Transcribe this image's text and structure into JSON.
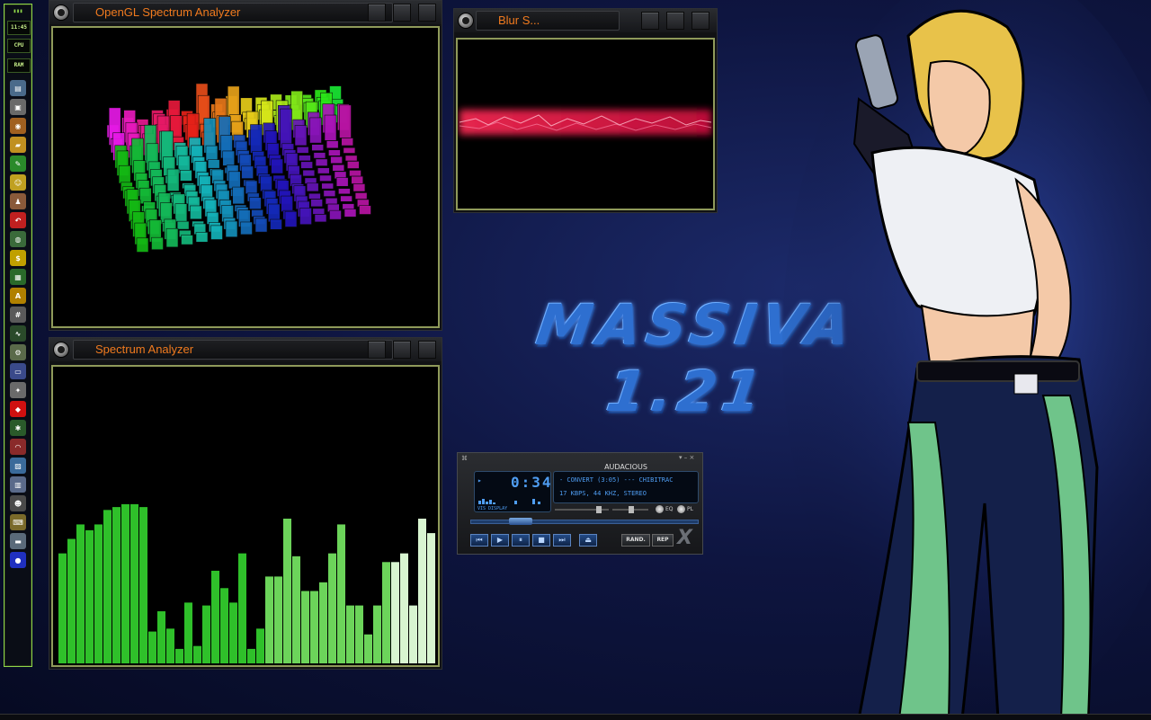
{
  "colors": {
    "accent": "#8fd64a",
    "title_text": "#f07a1e",
    "lcd_text": "#4f9df2",
    "pane_border": "#8f9a5a"
  },
  "dock": {
    "clock": "11:45",
    "meters": [
      "CPU",
      "RAM"
    ],
    "icons": [
      "terminal-icon",
      "monitor-icon",
      "sound-icon",
      "folder-icon",
      "paint-icon",
      "smiley-icon",
      "user-icon",
      "back-arrow-icon",
      "globe-icon",
      "dollar-icon",
      "calendar-icon",
      "font-icon",
      "calculator-icon",
      "waveform-icon",
      "gear-icon",
      "window-icon",
      "wrench-icon",
      "diamond-icon",
      "bug-icon",
      "wifi-icon",
      "chart-icon",
      "computer-icon",
      "alien-icon",
      "keyboard-icon",
      "printer-icon",
      "earth-icon"
    ]
  },
  "windows": {
    "opengl": {
      "title": "OpenGL Spectrum Analyzer"
    },
    "blur": {
      "title": "Blur S..."
    },
    "spectrum": {
      "title": "Spectrum Analyzer",
      "bars": [
        0.38,
        0.43,
        0.48,
        0.46,
        0.48,
        0.53,
        0.54,
        0.55,
        0.55,
        0.54,
        0.11,
        0.18,
        0.12,
        0.05,
        0.21,
        0.06,
        0.2,
        0.32,
        0.26,
        0.21,
        0.38,
        0.05,
        0.12,
        0.3,
        0.3,
        0.5,
        0.37,
        0.25,
        0.25,
        0.28,
        0.38,
        0.48,
        0.2,
        0.2,
        0.1,
        0.2,
        0.35,
        0.35,
        0.38,
        0.2,
        0.5,
        0.45,
        0.41,
        0.3,
        0.35
      ]
    }
  },
  "logo": {
    "line1": "MASSIVA",
    "line2": "1.21"
  },
  "player": {
    "name": "AUDACIOUS",
    "time": "0:34",
    "track": "- CONVERT (3:05) --- CHIBITRAC",
    "info": "17 KBPS, 44 KHZ, STEREO",
    "vis_label": "VIS DISPLAY",
    "eq_label": "EQ",
    "pl_label": "PL",
    "shuffle_label": "RAND.",
    "repeat_label": "REP",
    "controls": [
      "⏮",
      "▶",
      "⏸",
      "■",
      "⏭",
      "⏏"
    ]
  }
}
